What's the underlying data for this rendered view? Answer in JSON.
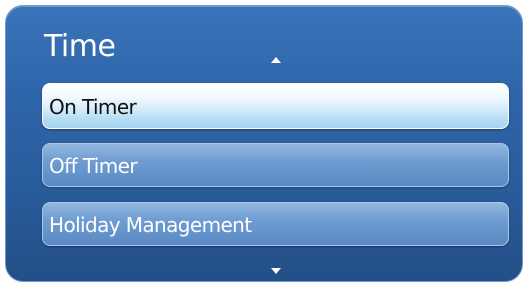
{
  "menu": {
    "title": "Time",
    "scroll_up_icon": "triangle-up",
    "scroll_down_icon": "triangle-down",
    "items": [
      {
        "label": "On Timer",
        "state": "focused"
      },
      {
        "label": "Off Timer",
        "state": "normal"
      },
      {
        "label": "Holiday Management",
        "state": "normal"
      }
    ]
  },
  "colors": {
    "panel_background": "#2f66ab",
    "focused_item": "#d2ebfa",
    "normal_item": "#6f9dd2",
    "title_text": "#ffffff"
  }
}
